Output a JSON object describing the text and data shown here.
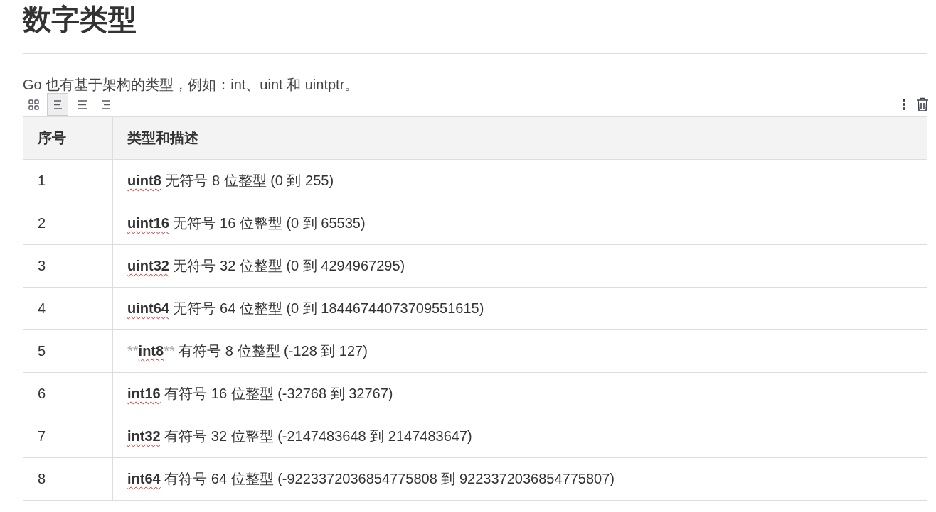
{
  "heading": "数字类型",
  "paragraph": "Go 也有基于架构的类型，例如：int、uint 和 uintptr。",
  "toolbar": {
    "align_buttons": [
      {
        "kind": "grid",
        "selected": false
      },
      {
        "kind": "left",
        "selected": true
      },
      {
        "kind": "center",
        "selected": false
      },
      {
        "kind": "right",
        "selected": false
      }
    ]
  },
  "table": {
    "columns": [
      "序号",
      "类型和描述"
    ],
    "rows": [
      {
        "number": "1",
        "type": "uint8",
        "description": " 无符号 8 位整型 (0 到 255)"
      },
      {
        "number": "2",
        "type": "uint16",
        "description": " 无符号 16 位整型 (0 到 65535)"
      },
      {
        "number": "3",
        "type": "uint32",
        "description": " 无符号 32 位整型 (0 到 4294967295)"
      },
      {
        "number": "4",
        "type": "uint64",
        "description": " 无符号 64 位整型 (0 到 18446744073709551615)"
      },
      {
        "number": "5",
        "type": "int8",
        "description": " 有符号 8 位整型 (-128 到 127)",
        "prefix": "**",
        "suffix": "**"
      },
      {
        "number": "6",
        "type": "int16",
        "description": " 有符号 16 位整型 (-32768 到 32767)"
      },
      {
        "number": "7",
        "type": "int32",
        "description": " 有符号 32 位整型 (-2147483648 到 2147483647)"
      },
      {
        "number": "8",
        "type": "int64",
        "description": " 有符号 64 位整型 (-9223372036854775808 到 9223372036854775807)"
      }
    ]
  }
}
